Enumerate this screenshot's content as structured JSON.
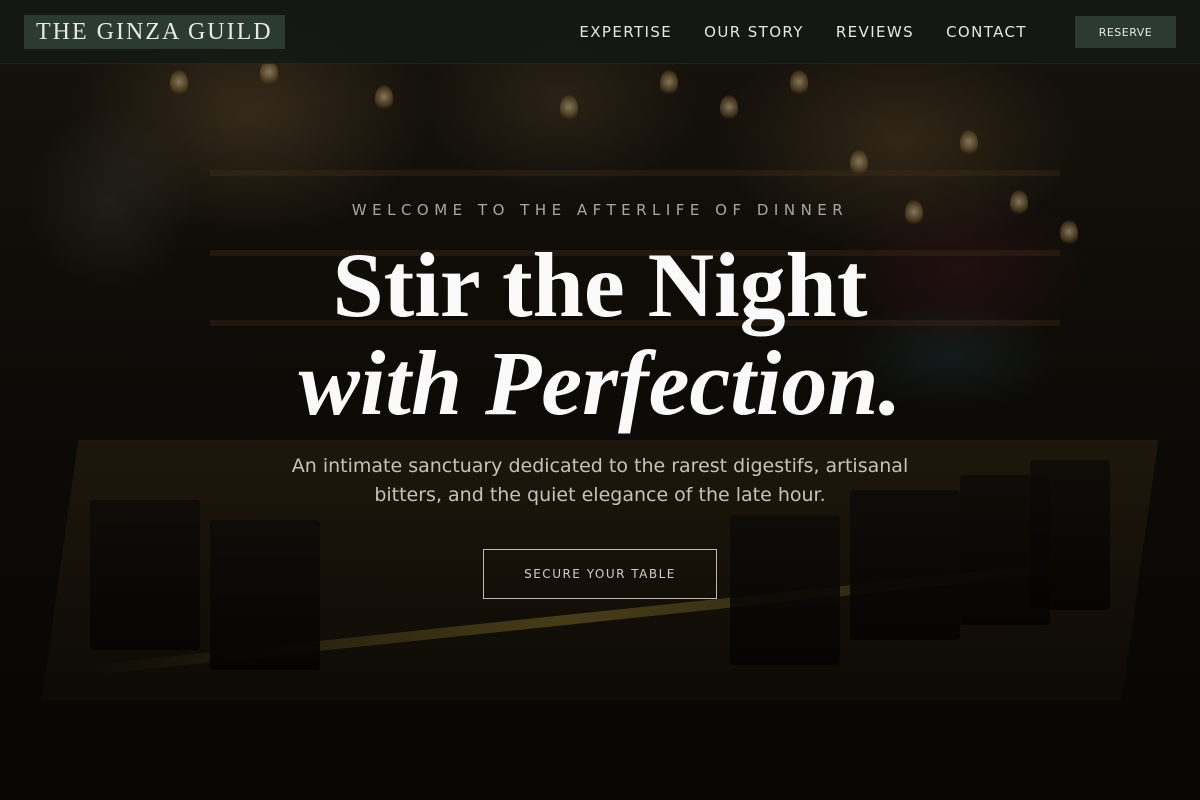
{
  "navbar": {
    "logo": "THE GINZA GUILD",
    "links": [
      {
        "label": "EXPERTISE"
      },
      {
        "label": "OUR STORY"
      },
      {
        "label": "REVIEWS"
      },
      {
        "label": "CONTACT"
      }
    ],
    "reserve_label": "RESERVE"
  },
  "hero": {
    "eyebrow": "WELCOME TO THE AFTERLIFE OF DINNER",
    "headline_line1": "Stir the Night",
    "headline_line2": "with Perfection.",
    "subtext": "An intimate sanctuary dedicated to the rarest digestifs, artisanal bitters, and the quiet elegance of the late hour.",
    "cta_label": "SECURE YOUR TABLE"
  },
  "colors": {
    "accent_green": "#2b3b32",
    "text_light": "#fafafa"
  }
}
